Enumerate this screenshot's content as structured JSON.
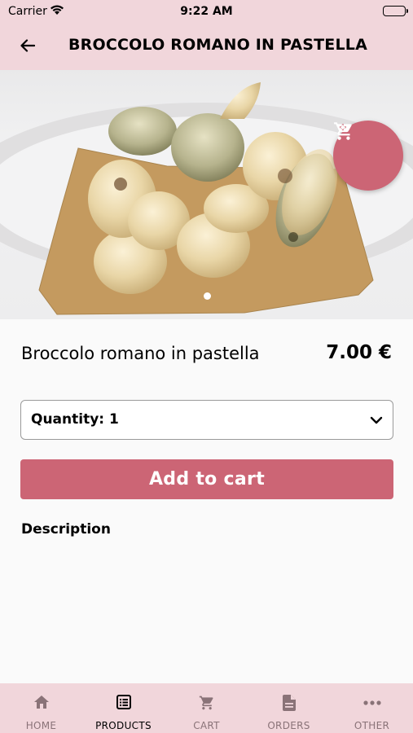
{
  "status_bar": {
    "carrier": "Carrier",
    "time": "9:22 AM"
  },
  "header": {
    "title": "BROCCOLO ROMANO IN PASTELLA",
    "back_icon": "arrow-left-icon"
  },
  "hero": {
    "cart_icon": "shopping-cart-icon",
    "slide_count": 1,
    "active_slide": 1
  },
  "product": {
    "name": "Broccolo romano in pastella",
    "price": "7.00 €"
  },
  "quantity": {
    "label": "Quantity: 1"
  },
  "actions": {
    "add_to_cart_label": "Add to cart"
  },
  "description": {
    "heading": "Description"
  },
  "tabs": [
    {
      "label": "HOME",
      "icon": "home-icon",
      "active": false
    },
    {
      "label": "PRODUCTS",
      "icon": "list-icon",
      "active": true
    },
    {
      "label": "CART",
      "icon": "cart-icon",
      "active": false
    },
    {
      "label": "ORDERS",
      "icon": "document-icon",
      "active": false
    },
    {
      "label": "OTHER",
      "icon": "more-icon",
      "active": false
    }
  ],
  "colors": {
    "header_background": "#f1d6db",
    "accent": "#cc6575",
    "tab_inactive": "#8a7378"
  }
}
